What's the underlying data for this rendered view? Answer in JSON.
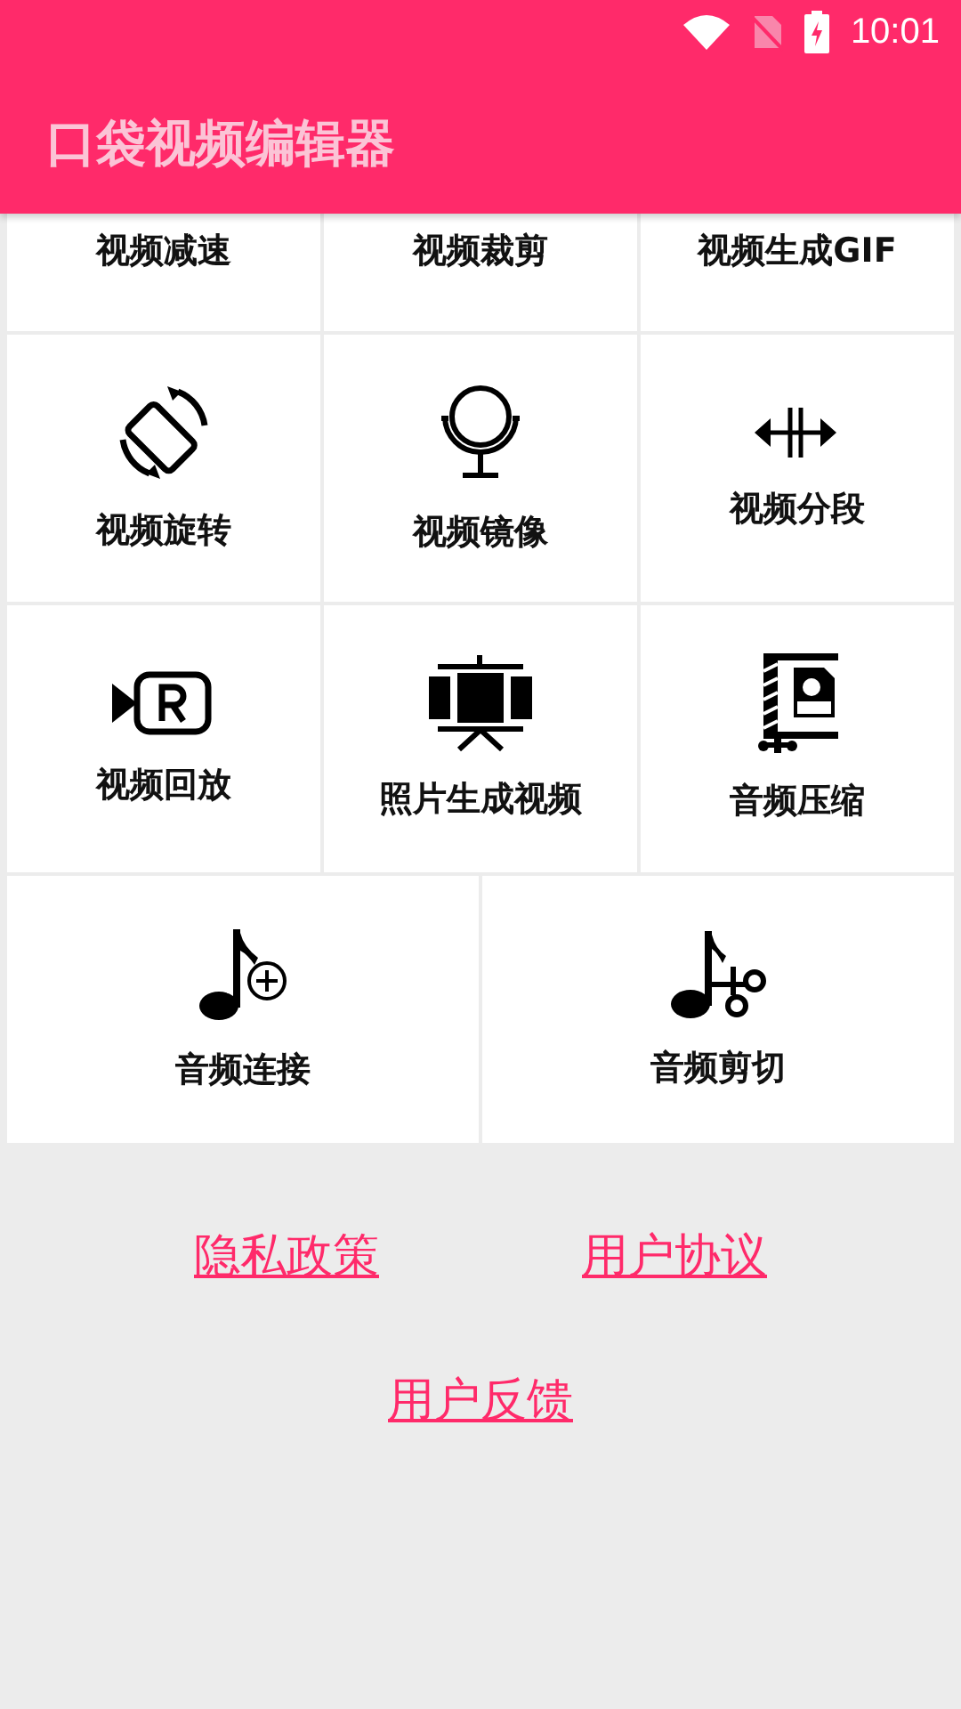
{
  "status_bar": {
    "time": "10:01"
  },
  "app_bar": {
    "title": "口袋视频编辑器"
  },
  "grid": {
    "clipped_row": [
      "视频减速",
      "视频裁剪",
      "视频生成GIF"
    ],
    "rows": [
      [
        "视频旋转",
        "视频镜像",
        "视频分段"
      ],
      [
        "视频回放",
        "照片生成视频",
        "音频压缩"
      ],
      [
        "音频连接",
        "音频剪切"
      ]
    ]
  },
  "links": [
    [
      "隐私政策",
      "用户协议"
    ],
    [
      "用户反馈"
    ]
  ]
}
